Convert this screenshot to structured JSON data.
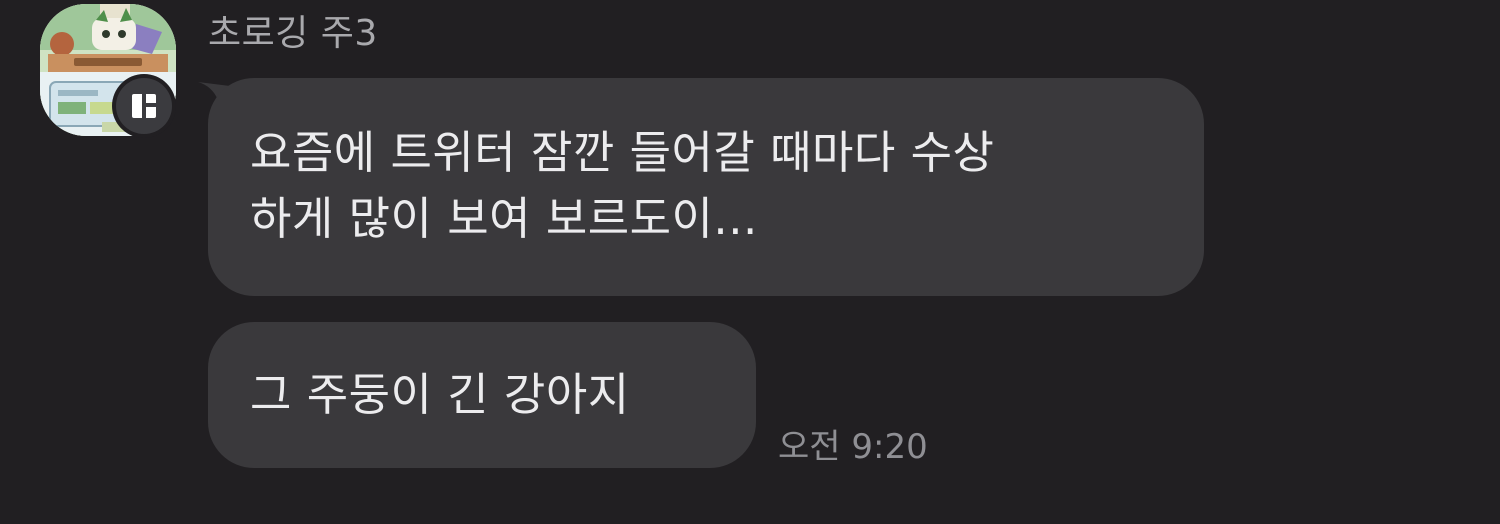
{
  "sender": {
    "name": "초로깅 주3"
  },
  "messages": [
    {
      "lines": [
        "요즘에 트위터 잠깐 들어갈 때마다 수상",
        "하게 많이 보여 보르도이..."
      ]
    },
    {
      "text": "그 주둥이 긴 강아지"
    }
  ],
  "timestamp": "오전 9:20",
  "colors": {
    "background": "#211f22",
    "bubble": "#3a393c",
    "bubble_text": "#ececee",
    "sender_name": "#a9a9ad",
    "timestamp": "#8f8f94"
  },
  "icons": {
    "avatar_badge": "channel-badge-icon"
  }
}
